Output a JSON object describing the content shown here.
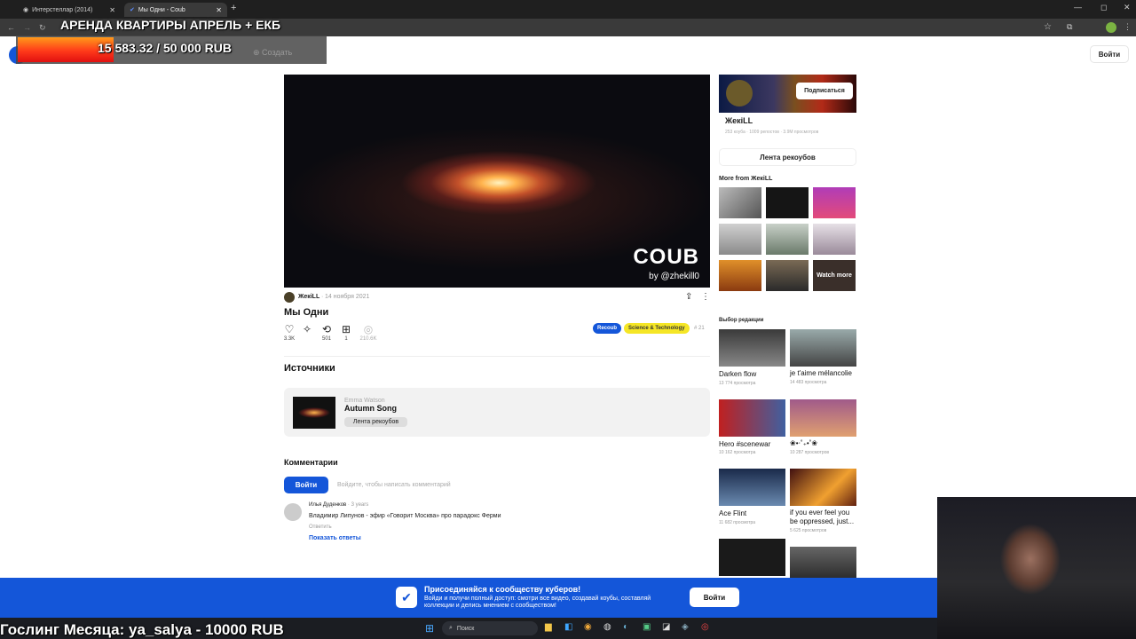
{
  "browser": {
    "tabs": [
      {
        "label": "Интерстеллар (2014)",
        "active": false
      },
      {
        "label": "Мы Одни - Coub",
        "active": true
      }
    ],
    "window_controls": [
      "—",
      "◻",
      "✕"
    ]
  },
  "stream_overlay": {
    "donation_title": "АРЕНДА КВАРТИРЫ АПРЕЛЬ + ЕКБ",
    "donation_amount": "15 583.32 / 50 000 RUB",
    "donation_progress": 0.312,
    "create_label": "Создать",
    "bottom_ticker": "Гослинг Месяца: ya_salya - 10000 RUB"
  },
  "header": {
    "login_label": "Войти"
  },
  "video": {
    "logo": "COUB",
    "by": "by @zhekill0",
    "author": "ЖекiLL",
    "date": "14 ноября 2021",
    "title": "Мы Одни",
    "stats": {
      "likes": "3.3K",
      "recoubs": "501",
      "saves": "1",
      "views": "210.6K"
    },
    "tags": [
      "Recoub",
      "Science & Technology"
    ],
    "tag_count": "# 21"
  },
  "sources": {
    "heading": "Источники",
    "artist": "Emma Watson",
    "song": "Autumn Song",
    "button": "Лента рекоубов"
  },
  "comments": {
    "heading": "Комментарии",
    "login_button": "Войти",
    "prompt": "Войдите, чтобы написать комментарий",
    "items": [
      {
        "author": "Илья Дуденков",
        "age": "3 years",
        "text": "Владимир Липунов - эфир «Говорит Москва» про парадокс Ферми",
        "reply": "Ответить",
        "show_replies": "Показать ответы"
      }
    ]
  },
  "sidebar": {
    "channel_name": "ЖекiLL",
    "channel_stats": "253 коуба · 1009 репостов · 3.9M просмотров",
    "subscribe": "Подписаться",
    "feed_button": "Лента рекоубов",
    "more_from": "More from ЖекiLL",
    "watch_more": "Watch more",
    "editors_choice": "Выбор редакции",
    "editors_items": [
      {
        "title": "Darken flow",
        "views": "13 774 просмотра"
      },
      {
        "title": "je t'aime mélancolie",
        "views": "14 483 просмотра"
      },
      {
        "title": "Hero #scenewar",
        "views": "10 162 просмотра"
      },
      {
        "title": "❀•‧˚₊•˚❀",
        "views": "10 287 просмотров"
      },
      {
        "title": "Ace Flint",
        "views": "11 682 просмотра"
      },
      {
        "title": "if you ever feel you be oppressed, just...",
        "views": "5 625 просмотров"
      }
    ]
  },
  "join_banner": {
    "title": "Присоединяйся к сообществу куберов!",
    "text": "Войди и получи полный доступ: смотри все видео, создавай коубы, составляй коллекции и делись мнением с сообществом!",
    "button": "Войти"
  },
  "taskbar": {
    "search_placeholder": "Поиск"
  },
  "colors": {
    "accent": "#1456d9",
    "recoub_tag": "#1456d9",
    "science_tag": "#f5e626"
  }
}
